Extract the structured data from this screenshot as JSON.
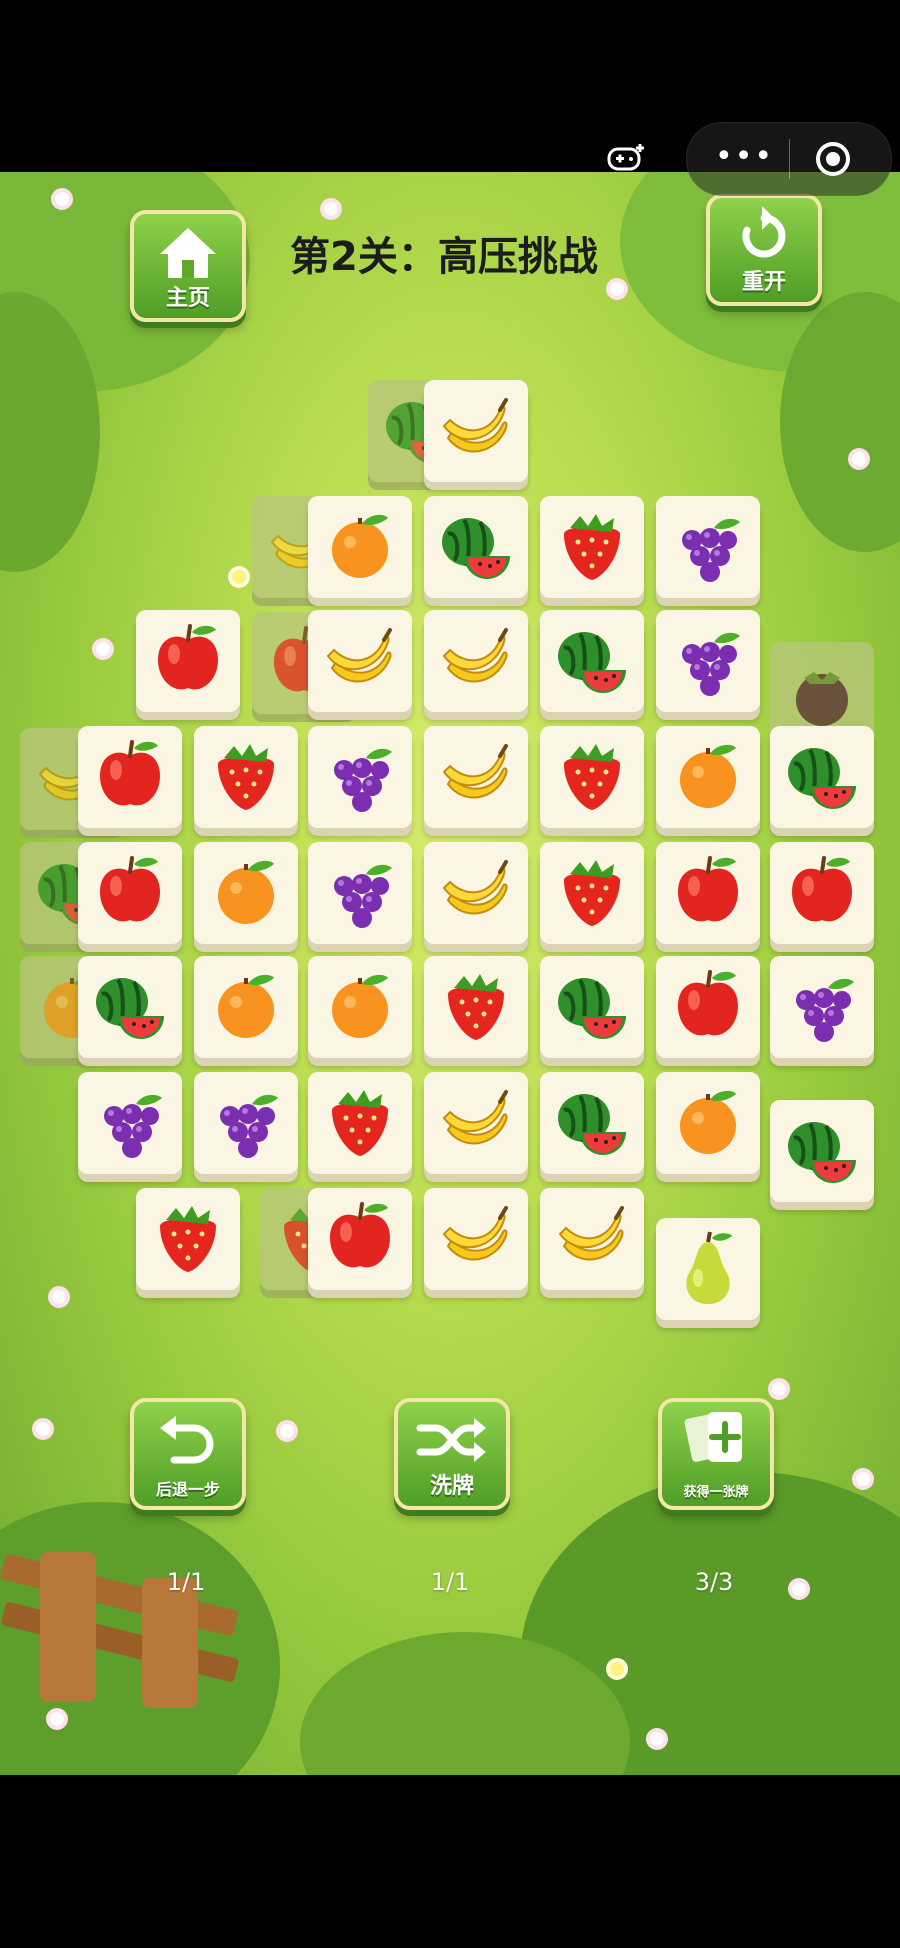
{
  "level": {
    "title": "第2关：高压挑战"
  },
  "buttons": {
    "home": {
      "label": "主页",
      "icon": "home-icon"
    },
    "restart": {
      "label": "重开",
      "icon": "restart-icon"
    },
    "undo": {
      "label": "后退一步",
      "icon": "undo-icon",
      "count": "1/1"
    },
    "shuffle": {
      "label": "洗牌",
      "icon": "shuffle-icon",
      "count": "1/1"
    },
    "extra": {
      "label": "获得一张牌",
      "icon": "add-card-icon",
      "count": "3/3"
    }
  },
  "colors": {
    "button_green": "#5fb130",
    "tile": "#fbf6e3",
    "field": "#b6db4e"
  },
  "board": {
    "covered_tiles": [
      "watermelon",
      "banana",
      "apple",
      "mangosteen",
      "banana",
      "watermelon",
      "orange",
      "strawberry"
    ],
    "rows": [
      [
        "banana"
      ],
      [
        "orange",
        "watermelon",
        "strawberry",
        "grape"
      ],
      [
        "apple",
        "banana",
        "banana",
        "watermelon",
        "grape"
      ],
      [
        "apple",
        "strawberry",
        "grape",
        "banana",
        "strawberry",
        "orange",
        "watermelon"
      ],
      [
        "apple",
        "orange",
        "grape",
        "banana",
        "strawberry",
        "apple",
        "apple"
      ],
      [
        "watermelon",
        "orange",
        "orange",
        "strawberry",
        "watermelon",
        "apple",
        "grape"
      ],
      [
        "grape",
        "grape",
        "strawberry",
        "banana",
        "watermelon",
        "orange",
        "watermelon"
      ],
      [
        "strawberry",
        "apple",
        "banana",
        "banana",
        "pear"
      ]
    ]
  }
}
